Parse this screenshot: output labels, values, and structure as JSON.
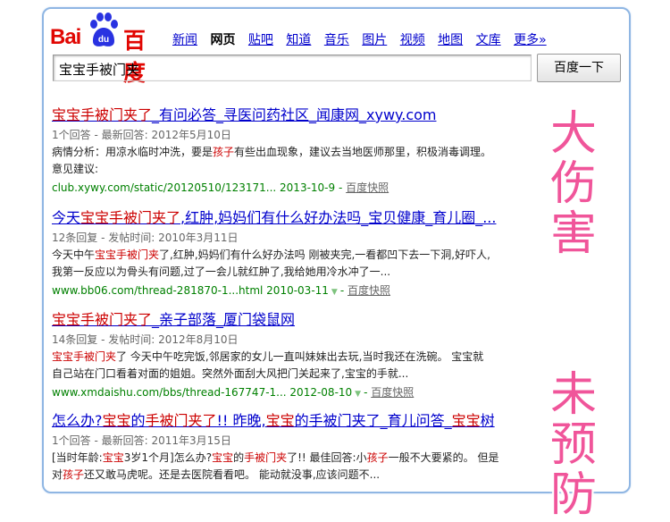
{
  "logo": {
    "bai": "Bai",
    "paw_text": "du",
    "du": "百度"
  },
  "nav": [
    "新闻",
    "网页",
    "贴吧",
    "知道",
    "音乐",
    "图片",
    "视频",
    "地图",
    "文库",
    "更多»"
  ],
  "search": {
    "value": "宝宝手被门夹",
    "button": "百度一下"
  },
  "results": [
    {
      "title": [
        {
          "t": "宝宝手被门夹了",
          "em": true
        },
        {
          "t": "_有问必答_寻医问药社区_闻康网_xywy.com",
          "em": false
        }
      ],
      "meta": "1个回答 - 最新回答: 2012年5月10日",
      "lines": [
        [
          {
            "t": "病情分析：用凉水临时冲洗，要是",
            "em": false
          },
          {
            "t": "孩子",
            "em": true
          },
          {
            "t": "有些出血现象，建议去当地医师那里，积极消毒调理。",
            "em": false
          }
        ],
        [
          {
            "t": "意见建议:",
            "em": false
          }
        ]
      ],
      "url": "club.xywy.com/static/20120510/123171... 2013-10-9",
      "snap": "百度快照",
      "tri": false
    },
    {
      "title": [
        {
          "t": "今天",
          "em": false
        },
        {
          "t": "宝宝手被门夹了",
          "em": true
        },
        {
          "t": ",红肿,妈妈们有什么好办法吗_宝贝健康_育儿圈_...",
          "em": false
        }
      ],
      "meta": "12条回复 - 发帖时间: 2010年3月11日",
      "lines": [
        [
          {
            "t": "今天中午",
            "em": false
          },
          {
            "t": "宝宝手被门夹",
            "em": true
          },
          {
            "t": "了,红肿,妈妈们有什么好办法吗  刚被夹完,一看都凹下去一下洞,好吓人,",
            "em": false
          }
        ],
        [
          {
            "t": "我第一反应以为骨头有问题,过了一会儿就红肿了,我给她用冷水冲了一...",
            "em": false
          }
        ]
      ],
      "url": "www.bb06.com/thread-281870-1...html 2010-03-11",
      "snap": "百度快照",
      "tri": true
    },
    {
      "title": [
        {
          "t": "宝宝手被门夹了",
          "em": true
        },
        {
          "t": "_亲子部落_厦门袋鼠网",
          "em": false
        }
      ],
      "meta": "14条回复 - 发帖时间: 2012年8月10日",
      "lines": [
        [
          {
            "t": "宝宝手被门夹",
            "em": true
          },
          {
            "t": "了  今天中午吃完饭,邻居家的女儿一直叫妹妹出去玩,当时我还在洗碗。  宝宝就",
            "em": false
          }
        ],
        [
          {
            "t": "自己站在门口看着对面的姐姐。突然外面刮大风把门关起来了,宝宝的手就...",
            "em": false
          }
        ]
      ],
      "url": "www.xmdaishu.com/bbs/thread-167747-1... 2012-08-10",
      "snap": "百度快照",
      "tri": true
    },
    {
      "title": [
        {
          "t": "怎么办?",
          "em": false
        },
        {
          "t": "宝宝",
          "em": true
        },
        {
          "t": "的",
          "em": false
        },
        {
          "t": "手被门夹了",
          "em": true
        },
        {
          "t": "!! 昨晚,",
          "em": false
        },
        {
          "t": "宝宝",
          "em": true
        },
        {
          "t": "的手被门夹了_育儿问答_",
          "em": false
        },
        {
          "t": "宝宝",
          "em": true
        },
        {
          "t": "树",
          "em": false
        }
      ],
      "meta": "1个回答 - 最新回答: 2011年3月15日",
      "lines": [
        [
          {
            "t": "[当时年龄:",
            "em": false
          },
          {
            "t": "宝宝",
            "em": true
          },
          {
            "t": "3岁1个月]怎么办?",
            "em": false
          },
          {
            "t": "宝宝",
            "em": true
          },
          {
            "t": "的",
            "em": false
          },
          {
            "t": "手被门夹",
            "em": true
          },
          {
            "t": "了!! 最佳回答:小",
            "em": false
          },
          {
            "t": "孩子",
            "em": true
          },
          {
            "t": "一般不大要紧的。 但是",
            "em": false
          }
        ],
        [
          {
            "t": "对",
            "em": false
          },
          {
            "t": "孩子",
            "em": true
          },
          {
            "t": "还又敢马虎呢。还是去医院看看吧。  能动就没事,应该问题不...",
            "em": false
          }
        ]
      ],
      "url": "",
      "snap": "",
      "tri": false
    }
  ],
  "side": {
    "top": "大伤害",
    "bottom": "未预防"
  }
}
